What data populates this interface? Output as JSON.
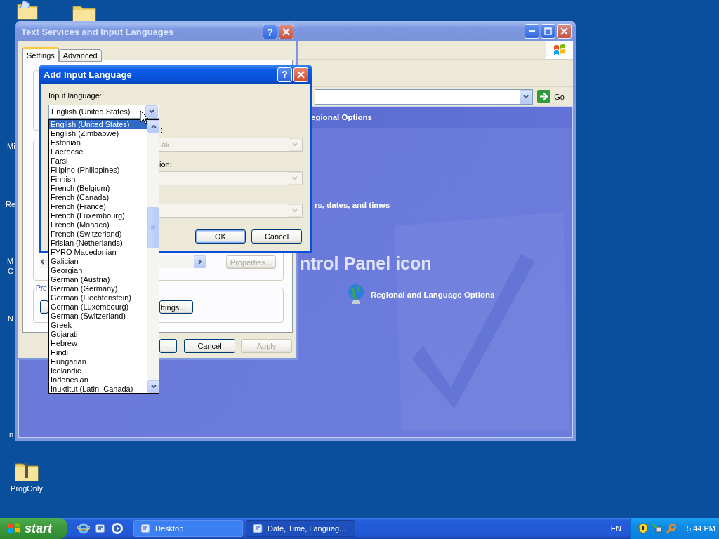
{
  "desktop": {
    "label_fragments": [
      "Mi",
      "Re",
      "M",
      "C",
      "N",
      "n"
    ],
    "icons": [
      {
        "label": "ProgOnly"
      }
    ]
  },
  "control_panel_window": {
    "go_button": "Go",
    "heading_fragment": "egional Options",
    "task_fragment": "rs, dates, and times",
    "banner_fragment": "ntrol Panel icon",
    "icon_item": "Regional and Language Options"
  },
  "text_services_window": {
    "title": "Text Services and Input Languages",
    "help_button": "?",
    "tabs": [
      {
        "label": "Settings",
        "selected": true
      },
      {
        "label": "Advanced",
        "selected": false
      }
    ],
    "group_fragment": "Pre",
    "settings_button_fragment": "ttings...",
    "properties_button": {
      "label": "Properties...",
      "disabled": true
    },
    "buttons": [
      {
        "label": "Cancel",
        "disabled": false
      },
      {
        "label": "Apply",
        "disabled": true
      }
    ]
  },
  "add_language_dialog": {
    "title": "Add Input Language",
    "help_button": "?",
    "input_language_label": "Input language:",
    "input_language_value": "English (United States)",
    "label_fragments": [
      ":",
      "ion:"
    ],
    "layout_fragment": "ak",
    "buttons": [
      {
        "label": "OK",
        "default": true
      },
      {
        "label": "Cancel",
        "default": false
      }
    ],
    "language_list": [
      {
        "label": "English (United States)",
        "selected": true
      },
      {
        "label": "English (Zimbabwe)",
        "selected": false
      },
      {
        "label": "Estonian",
        "selected": false
      },
      {
        "label": "Faeroese",
        "selected": false
      },
      {
        "label": "Farsi",
        "selected": false
      },
      {
        "label": "Filipino (Philippines)",
        "selected": false
      },
      {
        "label": "Finnish",
        "selected": false
      },
      {
        "label": "French (Belgium)",
        "selected": false
      },
      {
        "label": "French (Canada)",
        "selected": false
      },
      {
        "label": "French (France)",
        "selected": false
      },
      {
        "label": "French (Luxembourg)",
        "selected": false
      },
      {
        "label": "French (Monaco)",
        "selected": false
      },
      {
        "label": "French (Switzerland)",
        "selected": false
      },
      {
        "label": "Frisian (Netherlands)",
        "selected": false
      },
      {
        "label": "FYRO Macedonian",
        "selected": false
      },
      {
        "label": "Galician",
        "selected": false
      },
      {
        "label": "Georgian",
        "selected": false
      },
      {
        "label": "German (Austria)",
        "selected": false
      },
      {
        "label": "German (Germany)",
        "selected": false
      },
      {
        "label": "German (Liechtenstein)",
        "selected": false
      },
      {
        "label": "German (Luxembourg)",
        "selected": false
      },
      {
        "label": "German (Switzerland)",
        "selected": false
      },
      {
        "label": "Greek",
        "selected": false
      },
      {
        "label": "Gujarati",
        "selected": false
      },
      {
        "label": "Hebrew",
        "selected": false
      },
      {
        "label": "Hindi",
        "selected": false
      },
      {
        "label": "Hungarian",
        "selected": false
      },
      {
        "label": "Icelandic",
        "selected": false
      },
      {
        "label": "Indonesian",
        "selected": false
      },
      {
        "label": "Inuktitut (Latin, Canada)",
        "selected": false
      }
    ]
  },
  "taskbar": {
    "start": "start",
    "tasks": [
      {
        "label": "Desktop",
        "selected": false
      },
      {
        "label": "Date, Time, Languag...",
        "selected": true
      }
    ],
    "language": "EN",
    "clock": "5:44 PM"
  }
}
